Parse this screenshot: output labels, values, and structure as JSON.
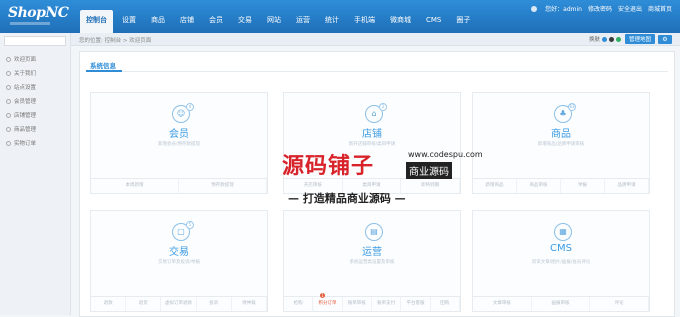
{
  "app": {
    "logo": "ShopNC"
  },
  "nav": {
    "tabs": [
      {
        "label": "控制台",
        "active": true
      },
      {
        "label": "设置"
      },
      {
        "label": "商品"
      },
      {
        "label": "店铺"
      },
      {
        "label": "会员"
      },
      {
        "label": "交易"
      },
      {
        "label": "网站"
      },
      {
        "label": "运营"
      },
      {
        "label": "统计"
      },
      {
        "label": "手机端"
      },
      {
        "label": "微商城"
      },
      {
        "label": "CMS"
      },
      {
        "label": "圈子"
      }
    ]
  },
  "user": {
    "greeting": "您好：admin",
    "change_password": "修改密码",
    "logout": "安全退出",
    "store_home": "商城首页"
  },
  "sidebar": {
    "items": [
      {
        "label": "欢迎页面"
      },
      {
        "label": "关于我们"
      },
      {
        "label": "站点设置"
      },
      {
        "label": "会员管理"
      },
      {
        "label": "店铺管理"
      },
      {
        "label": "商品管理"
      },
      {
        "label": "实物订单"
      }
    ]
  },
  "breadcrumb": "您的位置: 控制台 > 欢迎页面",
  "toolbar": {
    "skin_label": "换肤",
    "sitemap_button": "管理地图",
    "settings_icon": "gear-icon",
    "skin_colors": [
      "#2f8dd8",
      "#3a3a3a",
      "#2fae62"
    ]
  },
  "panel": {
    "title": "系统信息"
  },
  "cards": [
    {
      "title": "会员",
      "icon": "user-icon",
      "icon_glyph": "☺",
      "badge": "4",
      "desc": "新增会员/预存款提现",
      "links": [
        {
          "label": "本周新增"
        },
        {
          "label": "预存款提现"
        }
      ]
    },
    {
      "title": "店铺",
      "icon": "store-icon",
      "icon_glyph": "⌂",
      "badge": "2",
      "desc": "新开店铺审核/类目申请",
      "links": [
        {
          "label": "开店审核"
        },
        {
          "label": "类目申请"
        },
        {
          "label": "即将到期"
        }
      ]
    },
    {
      "title": "商品",
      "icon": "shirt-icon",
      "icon_glyph": "♣",
      "badge": "63",
      "desc": "新增商品/品牌申请审核",
      "links": [
        {
          "label": "新增商品"
        },
        {
          "label": "商品审核"
        },
        {
          "label": "举报"
        },
        {
          "label": "品牌申请"
        }
      ]
    },
    {
      "title": "交易",
      "icon": "bag-icon",
      "icon_glyph": "▢",
      "badge": "5",
      "desc": "交易订单及投诉/举报",
      "links": [
        {
          "label": "退款"
        },
        {
          "label": "退货"
        },
        {
          "label": "虚拟订单退款"
        },
        {
          "label": "投诉"
        },
        {
          "label": "待仲裁"
        }
      ]
    },
    {
      "title": "运营",
      "icon": "chart-icon",
      "icon_glyph": "▤",
      "badge": "",
      "desc": "系统运营类设置及审核",
      "links": [
        {
          "label": "抢购"
        },
        {
          "label": "积分订单",
          "highlight": true
        },
        {
          "label": "账单审核"
        },
        {
          "label": "账单支付"
        },
        {
          "label": "平台客服"
        },
        {
          "label": "团购"
        }
      ]
    },
    {
      "title": "CMS",
      "icon": "document-icon",
      "icon_glyph": "▦",
      "badge": "",
      "desc": "资讯文章/图片/画报/会员评论",
      "links": [
        {
          "label": "文章审核"
        },
        {
          "label": "画报审核"
        },
        {
          "label": "评论"
        }
      ]
    }
  ],
  "notice_badge": "1",
  "watermark": {
    "brand": "源码铺子",
    "url": "www.codespu.com",
    "biz": "商业源码",
    "slogan": "— 打造精品商业源码 —"
  }
}
